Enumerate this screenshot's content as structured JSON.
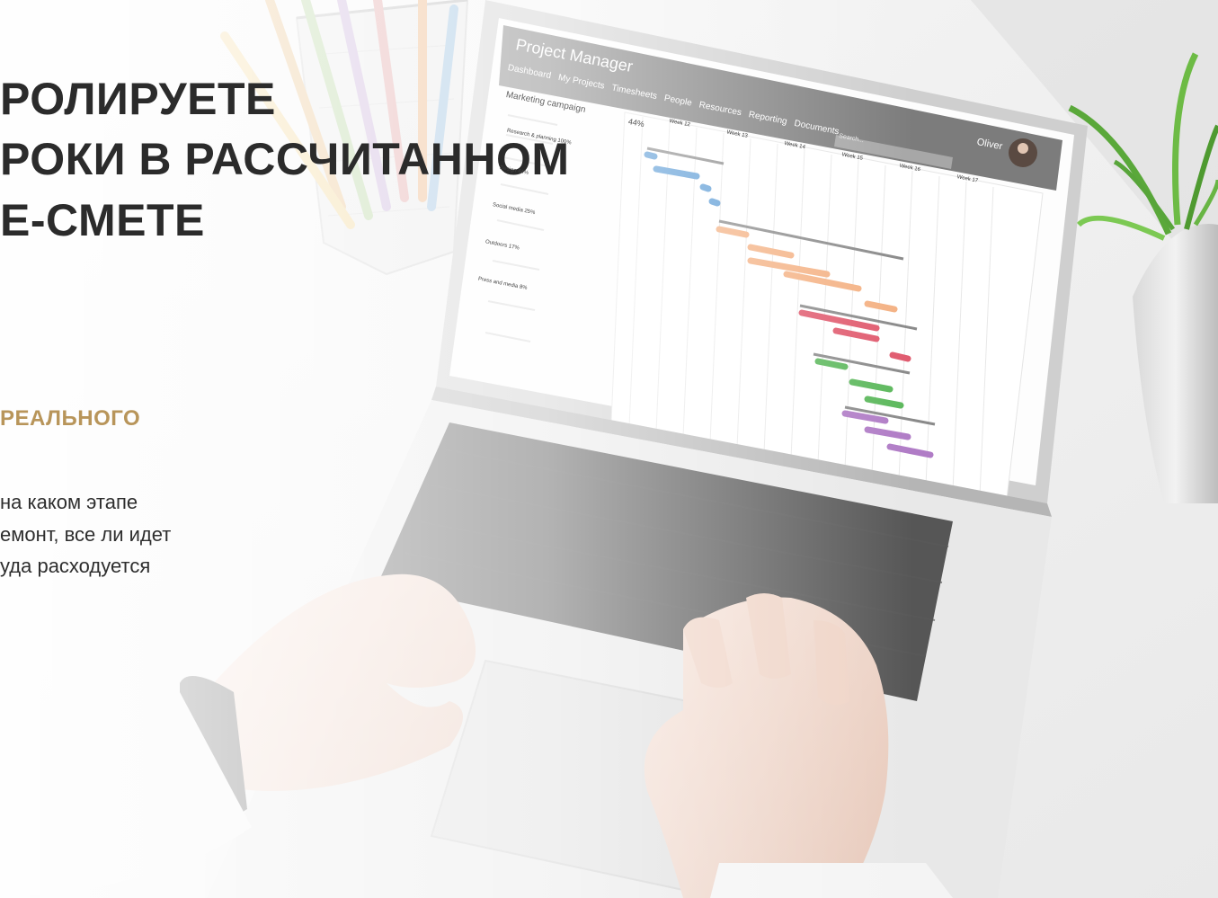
{
  "headline": {
    "line1": "РОЛИРУЕТЕ",
    "line2": "РОКИ В РАССЧИТАННОМ",
    "line3": "Е-СМЕТЕ"
  },
  "subheading": "РЕАЛЬНОГО",
  "body_text": {
    "line1": "на каком этапе",
    "line2": "емонт, все ли идет",
    "line3": "уда расходуется"
  },
  "screen_app": {
    "title": "Project Manager",
    "tabs": [
      "Dashboard",
      "My Projects",
      "Timesheets",
      "People",
      "Resources",
      "Reporting",
      "Documents"
    ],
    "user_name": "Oliver",
    "search_placeholder": "Search...",
    "project_name": "Marketing campaign",
    "overall_percent": "44%",
    "weeks": [
      "Week 12",
      "Week 13",
      "Week 14",
      "Week 15",
      "Week 16",
      "Week 17"
    ],
    "task_groups": [
      {
        "name": "Research & planning",
        "percent": "100%"
      },
      {
        "name": "Design",
        "percent": "44%"
      },
      {
        "name": "Social media",
        "percent": "25%"
      },
      {
        "name": "Outdoors",
        "percent": "17%"
      },
      {
        "name": "Press and media",
        "percent": "8%"
      }
    ]
  },
  "colors": {
    "headline": "#2b2b2b",
    "accent": "#b8955a",
    "bar_blue": "#5b9bd5",
    "bar_orange": "#f4b183",
    "bar_red": "#e05a6e",
    "bar_green": "#5cb85c",
    "bar_purple": "#b07cc6"
  }
}
